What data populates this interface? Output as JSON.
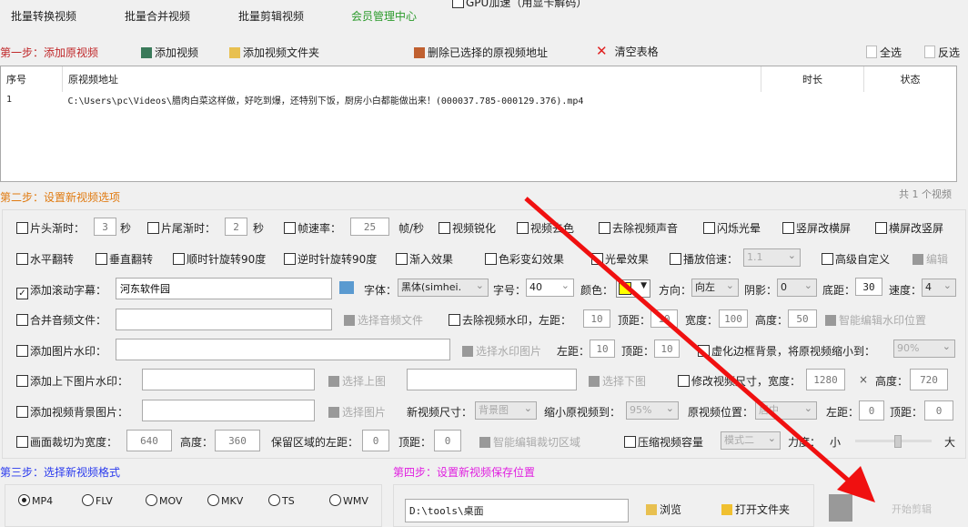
{
  "top": {
    "gpu": "GPU加速（用显卡解码）",
    "menu": [
      "批量转换视频",
      "批量合并视频",
      "批量剪辑视频",
      "会员管理中心"
    ]
  },
  "step1": {
    "title": "第一步：添加原视频",
    "add_video": "添加视频",
    "add_folder": "添加视频文件夹",
    "delete_selected": "删除已选择的原视频地址",
    "clear_table": "清空表格",
    "select_all": "全选",
    "invert": "反选"
  },
  "table": {
    "headers": [
      "序号",
      "原视频地址",
      "时长",
      "状态"
    ],
    "rows": [
      {
        "no": "1",
        "path": "C:\\Users\\pc\\Videos\\腊肉白菜这样做，好吃到爆，还特别下饭，厨房小白都能做出来！(000037.785-000129.376).mp4",
        "duration": "",
        "status": ""
      }
    ]
  },
  "step2": {
    "title": "第二步：设置新视频选项",
    "count": "共 1 个视频",
    "r1": {
      "fade_in": "片头渐时：",
      "fade_in_val": "3",
      "sec": "秒",
      "fade_out": "片尾渐时：",
      "fade_out_val": "2",
      "sec2": "秒",
      "fps": "帧速率：",
      "fps_val": "25",
      "fps_unit": "帧/秒",
      "sharpen": "视频锐化",
      "decolor": "视频去色",
      "mute": "去除视频声音",
      "flash": "闪烁光晕",
      "v2h": "竖屏改横屏",
      "h2v": "横屏改竖屏"
    },
    "r2": {
      "hflip": "水平翻转",
      "vflip": "垂直翻转",
      "cw": "顺时针旋转90度",
      "ccw": "逆时针旋转90度",
      "fadein": "渐入效果",
      "color": "色彩变幻效果",
      "halo": "光晕效果",
      "speed": "播放倍速：",
      "speed_val": "1.1",
      "custom": "高级自定义",
      "edit": "编辑"
    },
    "r3": {
      "subtitle": "添加滚动字幕：",
      "subtitle_val": "河东软件园",
      "font": "字体：",
      "font_val": "黑体(simhei.",
      "size": "字号：",
      "size_val": "40",
      "color": "颜色：",
      "color_hex": "#ffff00",
      "dir": "方向：",
      "dir_val": "向左",
      "shadow": "阴影：",
      "shadow_val": "0",
      "bottom": "底距：",
      "bottom_val": "30",
      "speed": "速度：",
      "speed_val": "4"
    },
    "r4": {
      "audio": "合并音频文件：",
      "choose_audio": "选择音频文件",
      "rm_wm": "去除视频水印，左距：",
      "left": "10",
      "top_l": "顶距：",
      "top": "10",
      "w_l": "宽度：",
      "w": "100",
      "h_l": "高度：",
      "h": "50",
      "smart": "智能编辑水印位置"
    },
    "r5": {
      "img_wm": "添加图片水印：",
      "choose": "选择水印图片",
      "left_l": "左距：",
      "left": "10",
      "top_l": "顶距：",
      "top": "10",
      "blur": "虚化边框背景，将原视频缩小到：",
      "blur_val": "90%"
    },
    "r6": {
      "tb_wm": "添加上下图片水印：",
      "choose_top": "选择上图",
      "choose_bottom": "选择下图",
      "resize": "修改视频尺寸，宽度：",
      "w": "1280",
      "x": "×",
      "h_l": "高度：",
      "h": "720"
    },
    "r7": {
      "bg": "添加视频背景图片：",
      "choose": "选择图片",
      "size_l": "新视频尺寸：",
      "size": "背景图",
      "shrink_l": "缩小原视频到：",
      "shrink": "95%",
      "pos_l": "原视频位置：",
      "pos": "居中",
      "left_l": "左距：",
      "left": "0",
      "top_l": "顶距：",
      "top": "0"
    },
    "r8": {
      "crop": "画面裁切为宽度：",
      "w": "640",
      "h_l": "高度：",
      "h": "360",
      "keep": "保留区域的左距：",
      "left": "0",
      "top_l": "顶距：",
      "top": "0",
      "smart": "智能编辑裁切区域",
      "compress": "压缩视频容量",
      "mode": "模式二",
      "force": "力度：",
      "small": "小",
      "big": "大",
      "force_level": 0.55
    }
  },
  "step3": {
    "title": "第三步：选择新视频格式",
    "formats": [
      "MP4",
      "FLV",
      "MOV",
      "MKV",
      "TS",
      "WMV"
    ],
    "selected": "MP4"
  },
  "step4": {
    "title": "第四步：设置新视频保存位置",
    "path": "D:\\tools\\桌面",
    "browse": "浏览",
    "open_folder": "打开文件夹",
    "start": "开始剪辑"
  }
}
